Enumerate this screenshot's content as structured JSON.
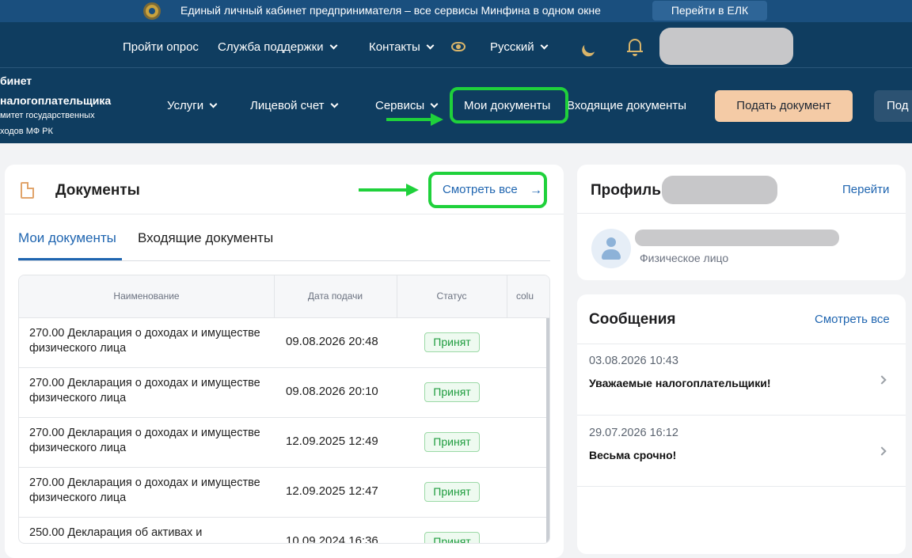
{
  "banner": {
    "text": "Единый личный кабинет предпринимателя – все сервисы Минфина в одном окне",
    "button": "Перейти в ЕЛК"
  },
  "utility": {
    "survey": "Пройти опрос",
    "support": "Служба поддержки",
    "contacts": "Контакты",
    "language": "Русский",
    "icons": [
      "eye-icon",
      "moon-icon",
      "bell-icon"
    ]
  },
  "brand": {
    "line1": "бинет",
    "line2": "налогоплательщика",
    "line3": "митет государственных",
    "line4": "ходов МФ РК"
  },
  "nav": {
    "services": "Услуги",
    "account": "Лицевой счет",
    "tools": "Сервисы",
    "my_docs": "Мои документы",
    "incoming": "Входящие документы",
    "submit": "Подать документ",
    "more": "Под"
  },
  "documents": {
    "title": "Документы",
    "see_all": "Смотреть все",
    "arrow": "→",
    "tabs": [
      "Мои документы",
      "Входящие документы"
    ],
    "columns": [
      "Наименование",
      "Дата подачи",
      "Статус",
      "colu"
    ],
    "rows": [
      {
        "name": "270.00 Декларация о доходах и имуществе физического лица",
        "date": "09.08.2026 20:48",
        "status": "Принят"
      },
      {
        "name": "270.00 Декларация о доходах и имуществе физического лица",
        "date": "09.08.2026 20:10",
        "status": "Принят"
      },
      {
        "name": "270.00 Декларация о доходах и имуществе физического лица",
        "date": "12.09.2025 12:49",
        "status": "Принят"
      },
      {
        "name": "270.00 Декларация о доходах и имуществе физического лица",
        "date": "12.09.2025 12:47",
        "status": "Принят"
      },
      {
        "name": "250.00 Декларация об активах и",
        "date": "10.09.2024 16:36",
        "status": "Принят"
      }
    ]
  },
  "profile": {
    "title": "Профиль",
    "go": "Перейти",
    "person_type": "Физическое лицо"
  },
  "messages": {
    "title": "Сообщения",
    "see_all": "Смотреть все",
    "items": [
      {
        "date": "03.08.2026 10:43",
        "text": "Уважаемые налогоплательщики!"
      },
      {
        "date": "29.07.2026 16:12",
        "text": "Весьма срочно!"
      }
    ]
  },
  "colors": {
    "header": "#0f3d60",
    "banner": "#1a4f7e",
    "accent": "#1f65b0",
    "submit": "#f4cba6",
    "highlight": "#1fd13b",
    "status_ok": "#1e9c3e"
  }
}
